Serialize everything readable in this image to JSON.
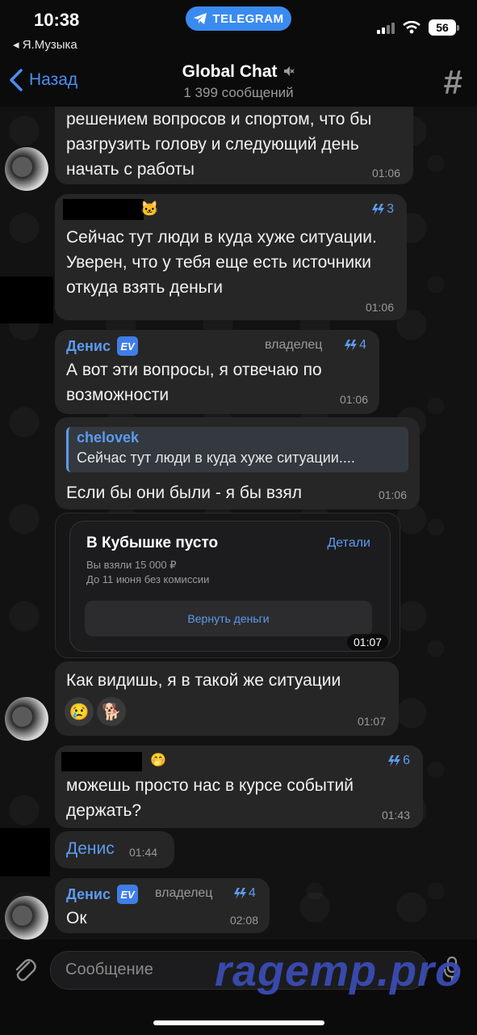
{
  "status_bar": {
    "time": "10:38",
    "pill": "TELEGRAM",
    "back_app": "◂ Я.Музыка",
    "battery": "56"
  },
  "header": {
    "back": "Назад",
    "title": "Global Chat",
    "subtitle": "1 399 сообщений"
  },
  "messages": [
    {
      "text": "решением вопросов и спортом, что бы разгрузить голову и следующий день начать с работы",
      "time": "01:06"
    },
    {
      "boost": "3",
      "text": "Сейчас тут люди в куда хуже ситуации. Уверен, что у тебя еще есть источники откуда взять деньги",
      "time": "01:06"
    },
    {
      "sender": "Денис",
      "badge": "EV",
      "role": "владелец",
      "boost": "4",
      "text": "А вот эти вопросы, я отвечаю по возможности",
      "time": "01:06"
    },
    {
      "reply_name": "chelovek",
      "reply_text": "Сейчас тут люди в куда хуже ситуации....",
      "text": "Если бы они были - я бы взял",
      "time": "01:06"
    },
    {
      "card_title": "В Кубышке пусто",
      "card_link": "Детали",
      "card_line1": "Вы взяли 15 000 ₽",
      "card_line2": "До 11 июня без комиссии",
      "card_button": "Вернуть деньги",
      "time": "01:07"
    },
    {
      "text": "Как видишь, я в такой же ситуации",
      "reactions": [
        "😢",
        "🐕"
      ],
      "time": "01:07"
    },
    {
      "boost": "6",
      "text": "можешь просто нас в курсе событий держать?",
      "time": "01:43"
    },
    {
      "text": "Денис",
      "time": "01:44"
    },
    {
      "sender": "Денис",
      "badge": "EV",
      "role": "владелец",
      "boost": "4",
      "text": "Ок",
      "time": "02:08"
    }
  ],
  "input": {
    "placeholder": "Сообщение"
  },
  "watermark": "ragemp.pro"
}
